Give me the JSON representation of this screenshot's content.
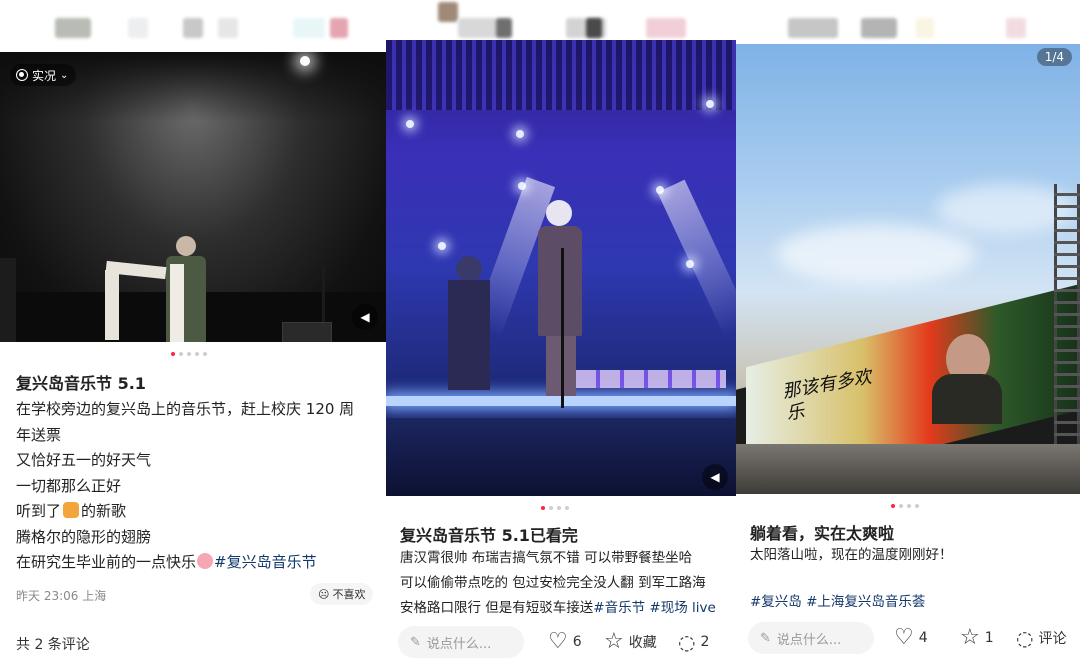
{
  "posts": [
    {
      "live_chip": "实况",
      "title": "复兴岛音乐节 5.1",
      "lines": [
        "在学校旁边的复兴岛上的音乐节，赶上校庆 120 周",
        "年送票",
        "又恰好五一的好天气",
        "一切都那么正好",
        "听到了",
        "的新歌",
        "腾格尔的隐形的翅膀",
        "在研究生毕业前的一点快乐"
      ],
      "tag": "#复兴岛音乐节",
      "meta": "昨天 23:06 上海",
      "not_interested": "不喜欢",
      "comments_count": "共 2 条评论",
      "dots": [
        true,
        false,
        false,
        false,
        false
      ]
    },
    {
      "title": "复兴岛音乐节 5.1已看完",
      "lines": [
        "唐汉霄很帅 布瑞吉搞气氛不错 可以带野餐垫坐哈",
        "可以偷偷带点吃的 包过安检完全没人翻 到军工路海",
        "安格路口限行 但是有短驳车接送"
      ],
      "tags": [
        "#音乐节",
        "#现场 live"
      ],
      "input_placeholder": "说点什么...",
      "likes": "6",
      "collect": "收藏",
      "comments": "2",
      "dots": [
        true,
        false,
        false,
        false
      ]
    },
    {
      "counter": "1/4",
      "banner_text": "那该有多欢乐",
      "title": "躺着看，实在太爽啦",
      "lines": [
        "太阳落山啦，现在的温度刚刚好！"
      ],
      "tags": [
        "#复兴岛",
        "#上海复兴岛音乐荟"
      ],
      "input_placeholder": "说点什么...",
      "likes": "4",
      "collect": "1",
      "comments": "评论",
      "dots": [
        true,
        false,
        false,
        false
      ]
    }
  ],
  "icons": {
    "tiger": "tiger-emoji",
    "pig": "pig-emoji",
    "live": "live-photo-icon",
    "mute": "mute-icon",
    "edit": "pencil-icon",
    "heart": "heart-icon",
    "star": "star-icon",
    "comment": "comment-icon"
  },
  "colors": {
    "accent": "#ff2442",
    "tag": "#13386c"
  }
}
